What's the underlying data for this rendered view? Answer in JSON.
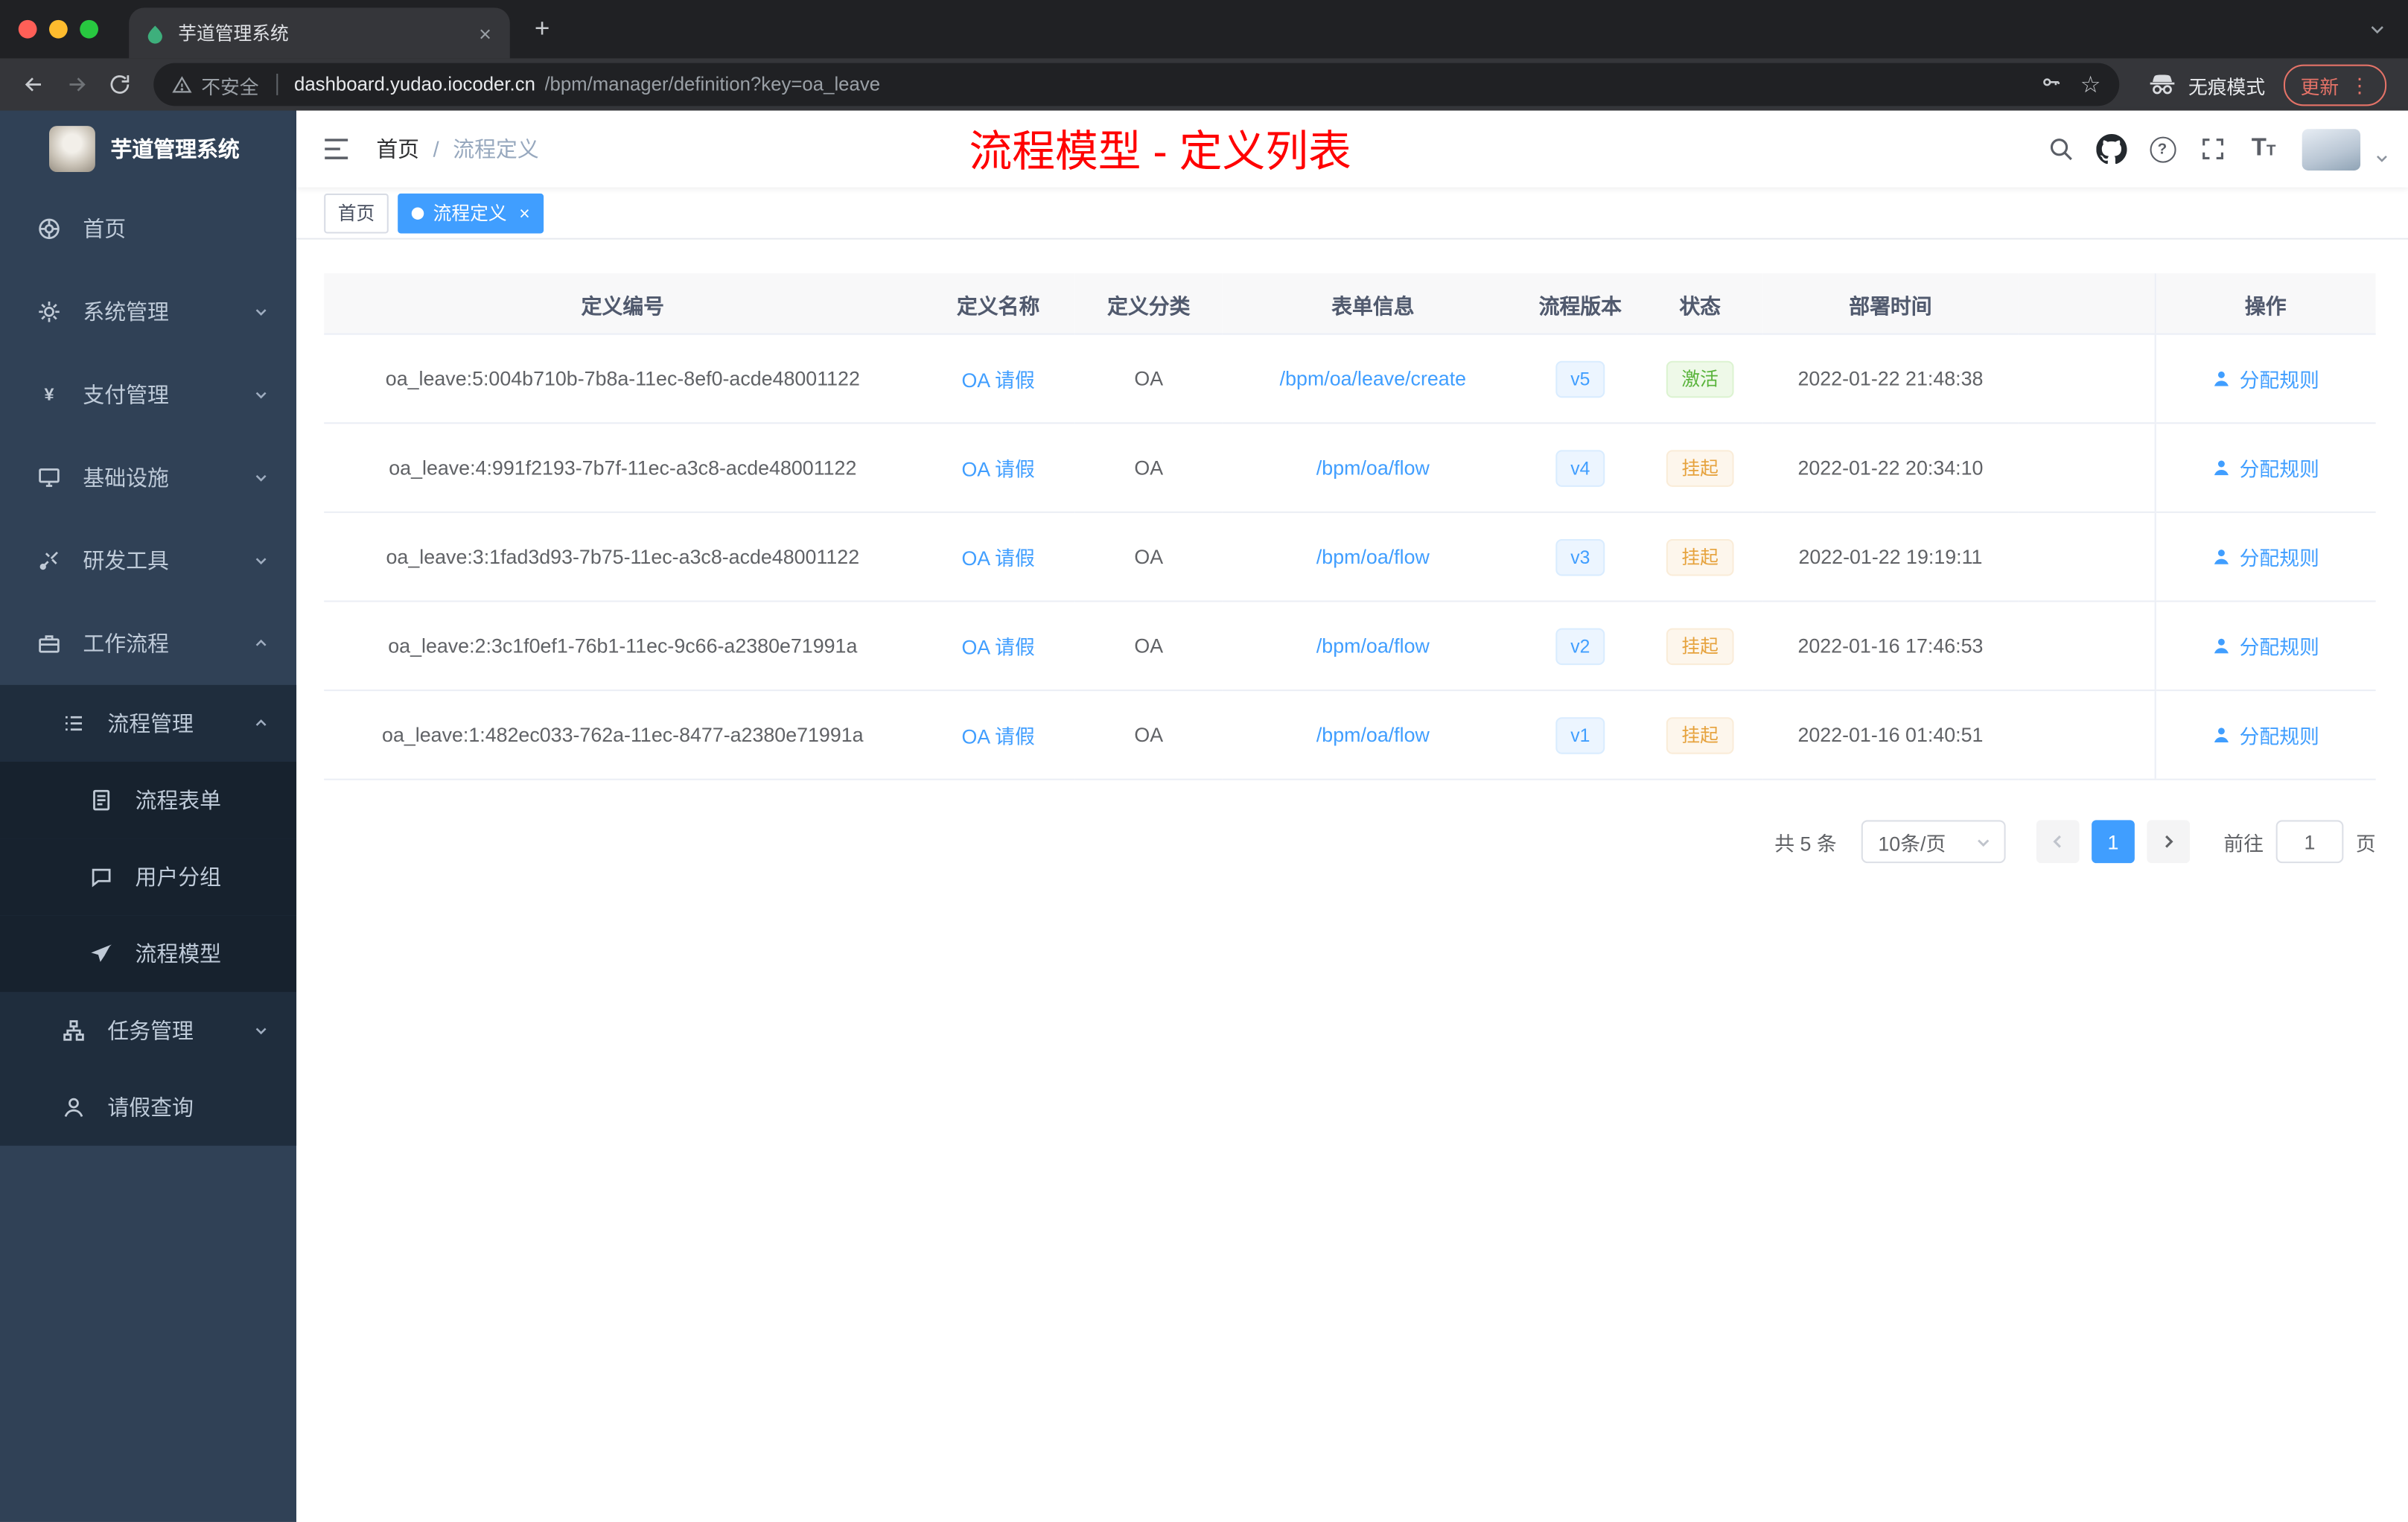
{
  "browser": {
    "tab_title": "芋道管理系统",
    "security_label": "不安全",
    "url_host": "dashboard.yudao.iocoder.cn",
    "url_path": "/bpm/manager/definition?key=oa_leave",
    "incognito_label": "无痕模式",
    "update_label": "更新"
  },
  "sidebar": {
    "logo_title": "芋道管理系统",
    "items": [
      {
        "key": "home",
        "label": "首页",
        "icon": "dashboard",
        "level": 1
      },
      {
        "key": "system-manage",
        "label": "系统管理",
        "icon": "gear",
        "level": 1,
        "chevron": "down"
      },
      {
        "key": "payment-manage",
        "label": "支付管理",
        "icon": "yen",
        "level": 1,
        "chevron": "down"
      },
      {
        "key": "infrastructure",
        "label": "基础设施",
        "icon": "monitor",
        "level": 1,
        "chevron": "down"
      },
      {
        "key": "dev-tools",
        "label": "研发工具",
        "icon": "tools",
        "level": 1,
        "chevron": "down"
      },
      {
        "key": "workflow",
        "label": "工作流程",
        "icon": "briefcase",
        "level": 1,
        "chevron": "up"
      },
      {
        "key": "process-manage",
        "label": "流程管理",
        "icon": "list",
        "level": 2,
        "chevron": "up"
      },
      {
        "key": "process-form",
        "label": "流程表单",
        "icon": "document",
        "level": 3
      },
      {
        "key": "user-group",
        "label": "用户分组",
        "icon": "chat",
        "level": 3
      },
      {
        "key": "process-model",
        "label": "流程模型",
        "icon": "plane",
        "level": 3
      },
      {
        "key": "task-manage",
        "label": "任务管理",
        "icon": "tree",
        "level": 2,
        "chevron": "down"
      },
      {
        "key": "leave-query",
        "label": "请假查询",
        "icon": "person",
        "level": 2
      }
    ]
  },
  "navbar": {
    "breadcrumb_home": "首页",
    "breadcrumb_separator": "/",
    "breadcrumb_current": "流程定义",
    "annotation": "流程模型 - 定义列表"
  },
  "tags": {
    "home_label": "首页",
    "active_label": "流程定义"
  },
  "table": {
    "headers": [
      "定义编号",
      "定义名称",
      "定义分类",
      "表单信息",
      "流程版本",
      "状态",
      "部署时间",
      "操作"
    ],
    "rows": [
      {
        "id": "oa_leave:5:004b710b-7b8a-11ec-8ef0-acde48001122",
        "name": "OA 请假",
        "category": "OA",
        "form": "/bpm/oa/leave/create",
        "version": "v5",
        "status": "激活",
        "status_type": "success",
        "time": "2022-01-22 21:48:38",
        "action": "分配规则"
      },
      {
        "id": "oa_leave:4:991f2193-7b7f-11ec-a3c8-acde48001122",
        "name": "OA 请假",
        "category": "OA",
        "form": "/bpm/oa/flow",
        "version": "v4",
        "status": "挂起",
        "status_type": "warning",
        "time": "2022-01-22 20:34:10",
        "action": "分配规则"
      },
      {
        "id": "oa_leave:3:1fad3d93-7b75-11ec-a3c8-acde48001122",
        "name": "OA 请假",
        "category": "OA",
        "form": "/bpm/oa/flow",
        "version": "v3",
        "status": "挂起",
        "status_type": "warning",
        "time": "2022-01-22 19:19:11",
        "action": "分配规则"
      },
      {
        "id": "oa_leave:2:3c1f0ef1-76b1-11ec-9c66-a2380e71991a",
        "name": "OA 请假",
        "category": "OA",
        "form": "/bpm/oa/flow",
        "version": "v2",
        "status": "挂起",
        "status_type": "warning",
        "time": "2022-01-16 17:46:53",
        "action": "分配规则"
      },
      {
        "id": "oa_leave:1:482ec033-762a-11ec-8477-a2380e71991a",
        "name": "OA 请假",
        "category": "OA",
        "form": "/bpm/oa/flow",
        "version": "v1",
        "status": "挂起",
        "status_type": "warning",
        "time": "2022-01-16 01:40:51",
        "action": "分配规则"
      }
    ]
  },
  "pagination": {
    "total": "共 5 条",
    "page_size": "10条/页",
    "current_page": "1",
    "goto_label": "前往",
    "goto_value": "1",
    "goto_unit": "页"
  },
  "colors": {
    "accent": "#409eff",
    "annotation": "#ff0000",
    "success": "#67c23a",
    "warning": "#e6a23c",
    "sidebar_bg": "#304156"
  }
}
